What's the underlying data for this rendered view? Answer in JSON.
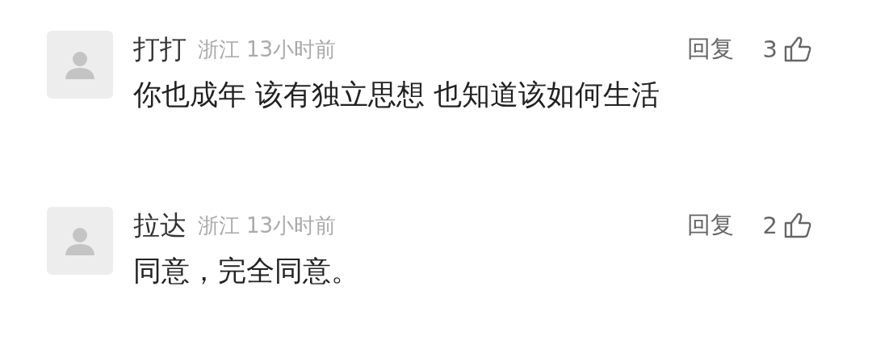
{
  "comments": [
    {
      "author": "打打",
      "location": "浙江",
      "time": "13小时前",
      "reply": "回复",
      "likes": "3",
      "text": "你也成年 该有独立思想 也知道该如何生活"
    },
    {
      "author": "拉达",
      "location": "浙江",
      "time": "13小时前",
      "reply": "回复",
      "likes": "2",
      "text": "同意，完全同意。"
    }
  ]
}
